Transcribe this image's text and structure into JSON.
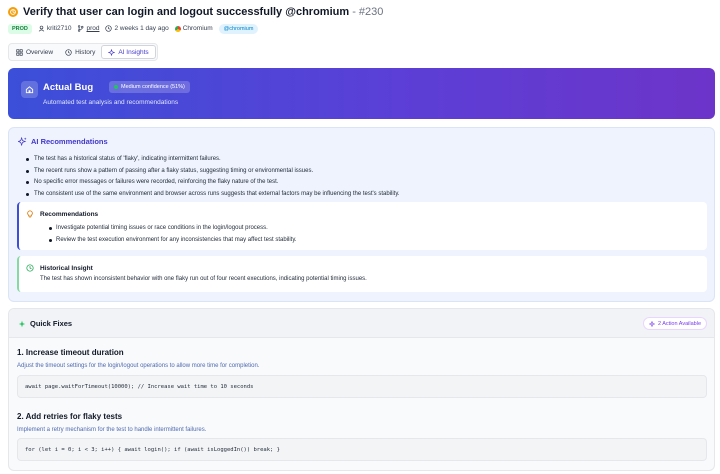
{
  "header": {
    "title": "Verify that user can login and logout successfully @chromium",
    "title_separator": " - ",
    "test_number": "#230",
    "env_badge": "PROD",
    "author": "kriti2710",
    "branch": "prod",
    "time": "2 weeks 1 day ago",
    "browser": "Chromium",
    "tag": "@chromium"
  },
  "tabs": [
    {
      "label": "Overview",
      "icon": "grid-icon",
      "active": false
    },
    {
      "label": "History",
      "icon": "clock-icon",
      "active": false
    },
    {
      "label": "AI Insights",
      "icon": "sparkle-icon",
      "active": true
    }
  ],
  "bug_card": {
    "title": "Actual Bug",
    "confidence": "Medium confidence (51%)",
    "subtitle": "Automated test analysis and recommendations"
  },
  "ai": {
    "heading": "AI Recommendations",
    "bullets": [
      "The test has a historical status of 'flaky', indicating intermittent failures.",
      "The recent runs show a pattern of passing after a flaky status, suggesting timing or environmental issues.",
      "No specific error messages or failures were recorded, reinforcing the flaky nature of the test.",
      "The consistent use of the same environment and browser across runs suggests that external factors may be influencing the test's stability."
    ],
    "recommendations": {
      "title": "Recommendations",
      "items": [
        "Investigate potential timing issues or race conditions in the login/logout process.",
        "Review the test execution environment for any inconsistencies that may affect test stability."
      ]
    },
    "historical": {
      "title": "Historical Insight",
      "text": "The test has shown inconsistent behavior with one flaky run out of four recent executions, indicating potential timing issues."
    }
  },
  "quick_fixes": {
    "heading": "Quick Fixes",
    "available": "2 Action Available",
    "fixes": [
      {
        "title": "1.  Increase timeout duration",
        "description": "Adjust the timeout settings for the login/logout operations to allow more time for completion.",
        "code": "await page.waitForTimeout(10000); // Increase wait time to 10 seconds"
      },
      {
        "title": "2.  Add retries for flaky tests",
        "description": "Implement a retry mechanism for the test to handle intermittent failures.",
        "code": "for (let i = 0; i < 3; i++) { await login(); if (await isLoggedIn()) break; }"
      }
    ]
  },
  "colors": {
    "accent": "#4338ca",
    "bug_gradient_start": "#3b4fd8",
    "bug_gradient_end": "#6d34c9",
    "prod_badge": "#15803d",
    "historical_border": "#86d9a3"
  }
}
